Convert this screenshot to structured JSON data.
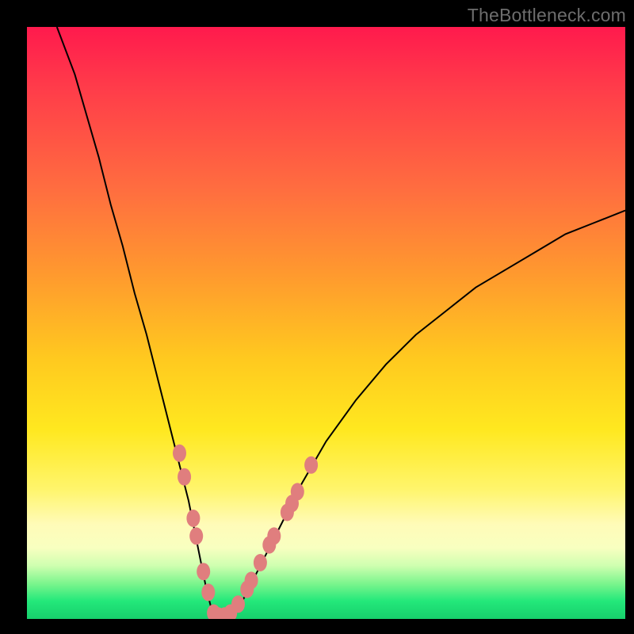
{
  "watermark": "TheBottleneck.com",
  "colors": {
    "curve": "#000000",
    "marker_fill": "#e07e7e",
    "marker_stroke": "#c65a5a",
    "gradient_top": "#ff1a4d",
    "gradient_bottom": "#17cf6c"
  },
  "chart_data": {
    "type": "line",
    "title": "",
    "xlabel": "",
    "ylabel": "",
    "xlim": [
      0,
      100
    ],
    "ylim": [
      0,
      100
    ],
    "series": [
      {
        "name": "bottleneck-curve",
        "x": [
          5,
          8,
          10,
          12,
          14,
          16,
          18,
          20,
          22,
          24,
          26,
          27,
          28,
          29,
          30,
          31,
          32,
          33,
          34,
          36,
          38,
          40,
          42,
          44,
          46,
          50,
          55,
          60,
          65,
          70,
          75,
          80,
          85,
          90,
          95,
          100
        ],
        "y": [
          100,
          92,
          85,
          78,
          70,
          63,
          55,
          48,
          40,
          32,
          24,
          20,
          15,
          10,
          5,
          1,
          0.5,
          0.5,
          1,
          3,
          7,
          11,
          15,
          19,
          23,
          30,
          37,
          43,
          48,
          52,
          56,
          59,
          62,
          65,
          67,
          69
        ]
      }
    ],
    "markers": [
      {
        "x": 25.5,
        "y": 28
      },
      {
        "x": 26.3,
        "y": 24
      },
      {
        "x": 27.8,
        "y": 17
      },
      {
        "x": 28.3,
        "y": 14
      },
      {
        "x": 29.5,
        "y": 8
      },
      {
        "x": 30.3,
        "y": 4.5
      },
      {
        "x": 31.2,
        "y": 1
      },
      {
        "x": 32.0,
        "y": 0.5
      },
      {
        "x": 33.0,
        "y": 0.5
      },
      {
        "x": 34.0,
        "y": 1
      },
      {
        "x": 35.3,
        "y": 2.5
      },
      {
        "x": 36.8,
        "y": 5
      },
      {
        "x": 37.5,
        "y": 6.5
      },
      {
        "x": 39.0,
        "y": 9.5
      },
      {
        "x": 40.5,
        "y": 12.5
      },
      {
        "x": 41.3,
        "y": 14
      },
      {
        "x": 43.5,
        "y": 18
      },
      {
        "x": 44.3,
        "y": 19.5
      },
      {
        "x": 45.2,
        "y": 21.5
      },
      {
        "x": 47.5,
        "y": 26
      }
    ]
  }
}
